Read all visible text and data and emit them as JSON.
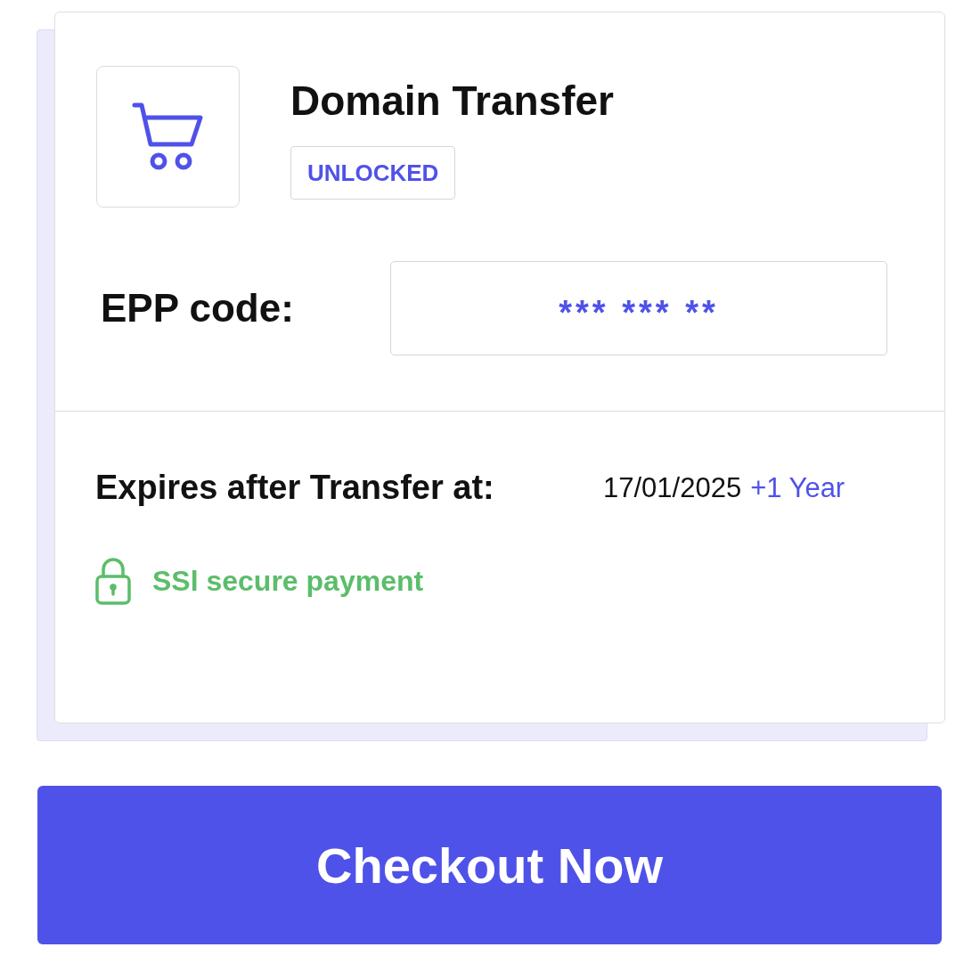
{
  "product": {
    "title": "Domain Transfer",
    "status": "UNLOCKED"
  },
  "epp": {
    "label": "EPP code:",
    "value": "*** *** **"
  },
  "expiry": {
    "label": "Expires after Transfer at:",
    "date": "17/01/2025",
    "extension": "+1 Year"
  },
  "security": {
    "text": "SSl secure payment"
  },
  "button": {
    "label": "Checkout Now"
  }
}
